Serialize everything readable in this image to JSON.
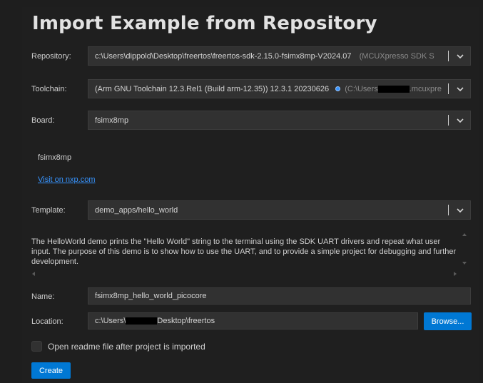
{
  "dialog": {
    "title": "Import Example from Repository"
  },
  "repository": {
    "label": "Repository:",
    "value": "c:\\Users\\dippold\\Desktop\\freertos\\freertos-sdk-2.15.0-fsimx8mp-V2024.07",
    "hint": "(MCUXpresso SDK S"
  },
  "toolchain": {
    "label": "Toolchain:",
    "value": "(Arm GNU Toolchain 12.3.Rel1 (Build arm-12.35)) 12.3.1 20230626",
    "path_prefix": "(C:\\Users",
    "path_suffix": ".mcuxpre"
  },
  "board": {
    "label": "Board:",
    "value": "fsimx8mp",
    "name": "fsimx8mp",
    "link": "Visit on nxp.com"
  },
  "template": {
    "label": "Template:",
    "value": "demo_apps/hello_world",
    "description": "The HelloWorld demo prints the \"Hello World\" string to the terminal using the SDK UART drivers and repeat what user input. The purpose of this demo is to show how to use the UART, and to provide a simple project for debugging and further development."
  },
  "name": {
    "label": "Name:",
    "value": "fsimx8mp_hello_world_picocore"
  },
  "location": {
    "label": "Location:",
    "value_prefix": "c:\\Users\\",
    "value_suffix": "Desktop\\freertos",
    "browse_label": "Browse..."
  },
  "options": {
    "open_readme_label": "Open readme file after project is imported",
    "open_readme_checked": false
  },
  "actions": {
    "create_label": "Create"
  },
  "colors": {
    "accent": "#0078d4",
    "link": "#3794ff",
    "background": "#1f1f1f",
    "input": "#313131"
  },
  "icons": {
    "dropdown": "chevron-down-icon",
    "info": "info-dot-icon"
  }
}
